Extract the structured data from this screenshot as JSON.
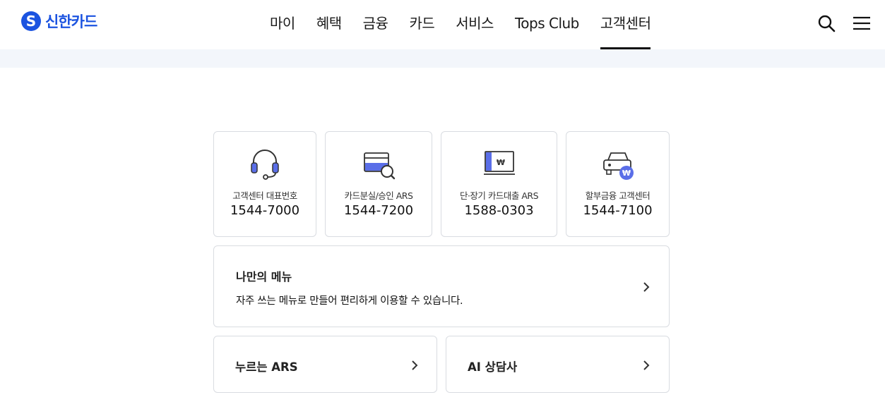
{
  "brand": {
    "logo_text": "신한카드",
    "color": "#1b53e0"
  },
  "nav": {
    "items": [
      "마이",
      "혜택",
      "금융",
      "카드",
      "서비스",
      "Tops Club",
      "고객센터"
    ],
    "active": "고객센터"
  },
  "header_icons": [
    "search-icon",
    "menu-icon"
  ],
  "contacts": [
    {
      "icon": "headset-icon",
      "label": "고객센터 대표번호",
      "phone": "1544-7000"
    },
    {
      "icon": "card-search-icon",
      "label": "카드분실/승인 ARS",
      "phone": "1544-7200"
    },
    {
      "icon": "loan-icon",
      "label": "단·장기 카드대출 ARS",
      "phone": "1588-0303"
    },
    {
      "icon": "car-won-icon",
      "label": "할부금융 고객센터",
      "phone": "1544-7100"
    }
  ],
  "my_menu": {
    "title": "나만의 메뉴",
    "description": "자주 쓰는 메뉴로 만들어 편리하게 이용할 수 있습니다."
  },
  "links": [
    {
      "title": "누르는 ARS"
    },
    {
      "title": "AI 상담사"
    }
  ],
  "colors": {
    "accent": "#5a6ee8",
    "band": "#f3f6fb",
    "border": "#d9dce1"
  }
}
